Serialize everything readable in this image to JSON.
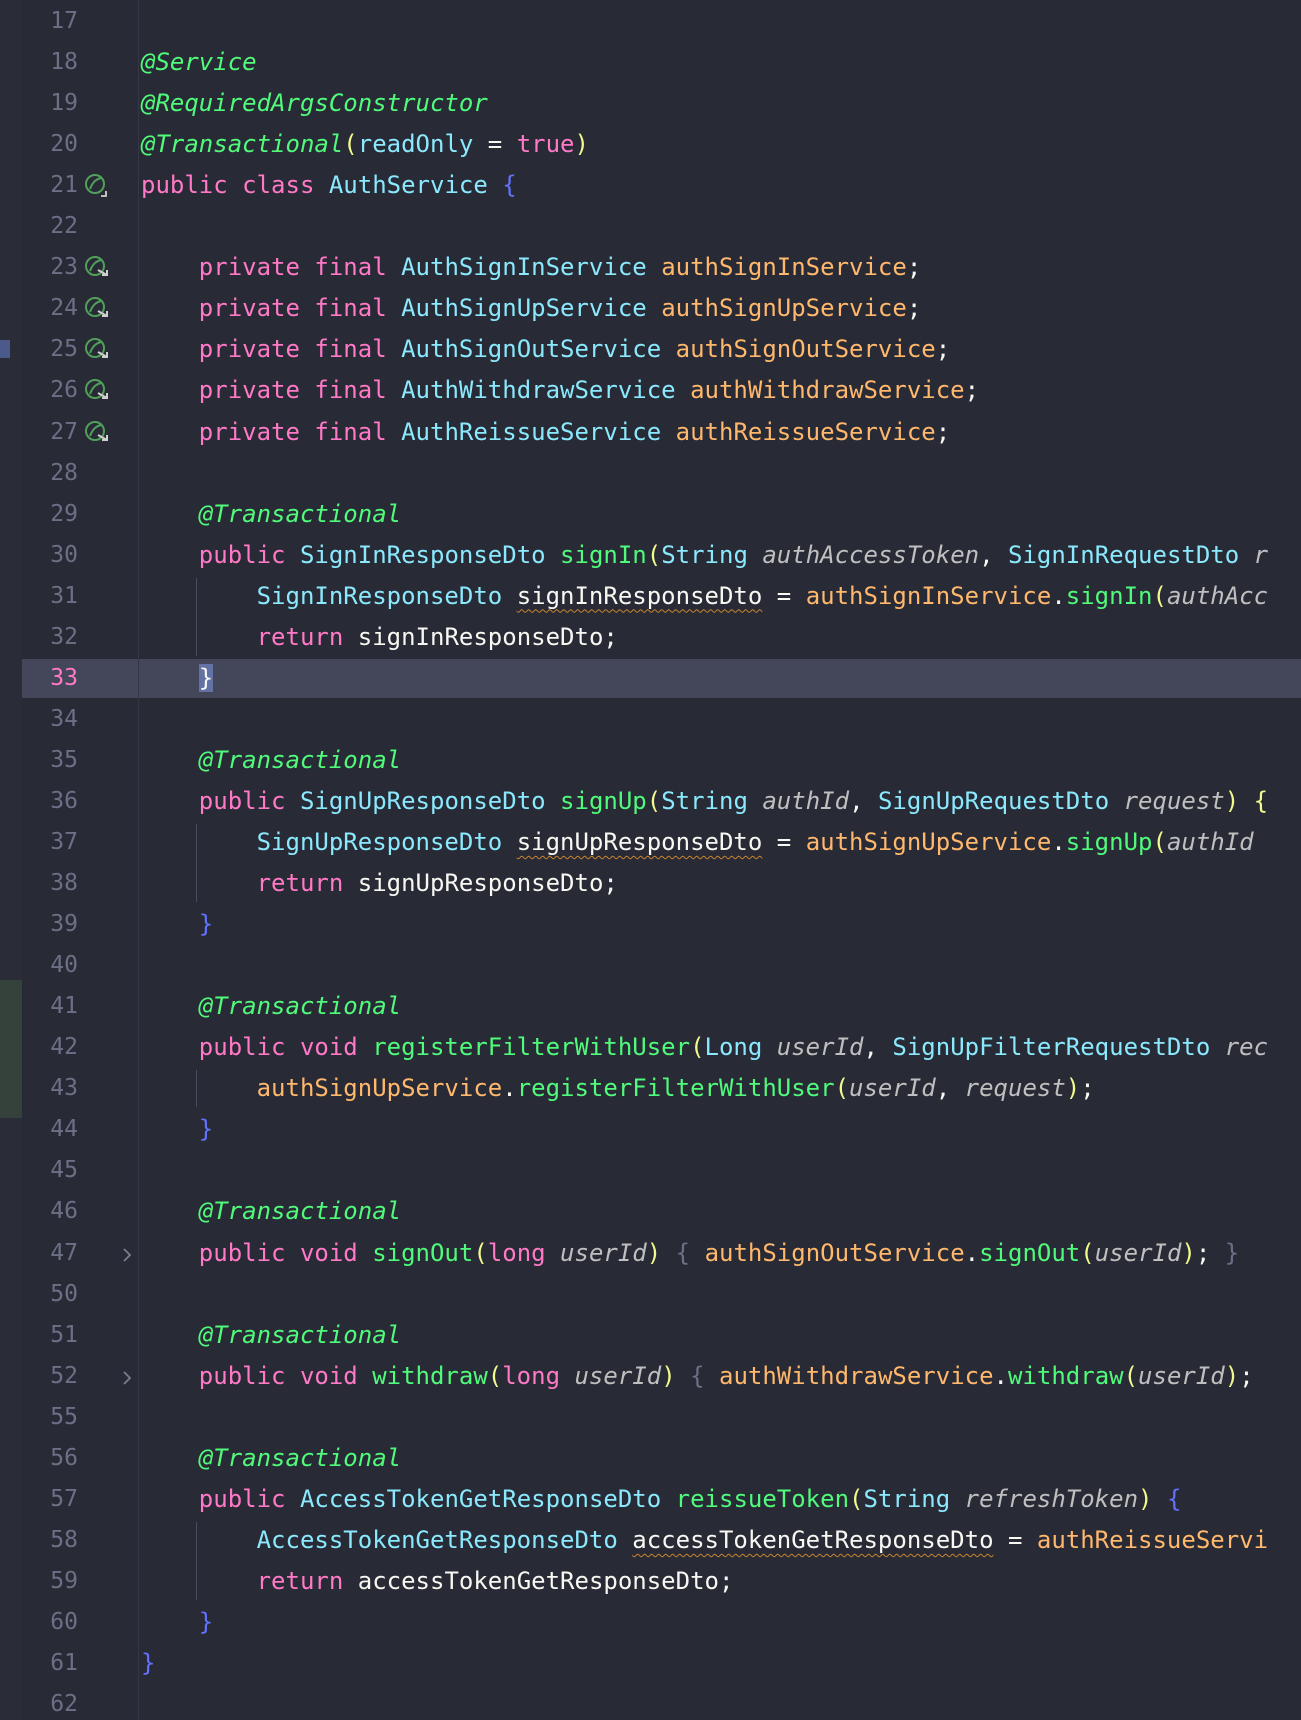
{
  "colors": {
    "background": "#282a36",
    "annotation": "#50fa7b",
    "keyword": "#ff79c6",
    "type": "#8be9fd",
    "field": "#ffb86c",
    "method": "#50fa7b",
    "param": "#bfbfbf",
    "plain": "#f8f8f2",
    "brace": "#6272ff",
    "paren": "#f1fa8c",
    "current_line_number": "#ff79c6"
  },
  "gutter_icons": [
    {
      "line": "21",
      "icon": "spring-bean-class-icon"
    },
    {
      "line": "23",
      "icon": "spring-bean-navigate-icon"
    },
    {
      "line": "24",
      "icon": "spring-bean-navigate-icon"
    },
    {
      "line": "25",
      "icon": "spring-bean-navigate-icon"
    },
    {
      "line": "26",
      "icon": "spring-bean-navigate-icon"
    },
    {
      "line": "27",
      "icon": "spring-bean-navigate-icon"
    }
  ],
  "fold_icons": [
    {
      "line": "47",
      "icon": "chevron-right-icon"
    },
    {
      "line": "52",
      "icon": "chevron-right-icon"
    }
  ],
  "current_line": "33",
  "lines": [
    {
      "n": "17",
      "tokens": []
    },
    {
      "n": "18",
      "tokens": [
        {
          "t": "@Service",
          "c": "annotation",
          "i": true
        }
      ]
    },
    {
      "n": "19",
      "tokens": [
        {
          "t": "@RequiredArgsConstructor",
          "c": "annotation",
          "i": true
        }
      ]
    },
    {
      "n": "20",
      "tokens": [
        {
          "t": "@Transactional",
          "c": "annotation",
          "i": true
        },
        {
          "t": "(",
          "c": "paren"
        },
        {
          "t": "readOnly",
          "c": "type"
        },
        {
          "t": " = ",
          "c": "plain"
        },
        {
          "t": "true",
          "c": "keyword"
        },
        {
          "t": ")",
          "c": "paren"
        }
      ]
    },
    {
      "n": "21",
      "tokens": [
        {
          "t": "public class ",
          "c": "keyword"
        },
        {
          "t": "AuthService",
          "c": "type"
        },
        {
          "t": " {",
          "c": "brace"
        }
      ]
    },
    {
      "n": "22",
      "tokens": []
    },
    {
      "n": "23",
      "tokens": [
        {
          "t": "    private final ",
          "c": "keyword"
        },
        {
          "t": "AuthSignInService ",
          "c": "type"
        },
        {
          "t": "authSignInService",
          "c": "field"
        },
        {
          "t": ";",
          "c": "plain"
        }
      ]
    },
    {
      "n": "24",
      "tokens": [
        {
          "t": "    private final ",
          "c": "keyword"
        },
        {
          "t": "AuthSignUpService ",
          "c": "type"
        },
        {
          "t": "authSignUpService",
          "c": "field"
        },
        {
          "t": ";",
          "c": "plain"
        }
      ]
    },
    {
      "n": "25",
      "tokens": [
        {
          "t": "    private final ",
          "c": "keyword"
        },
        {
          "t": "AuthSignOutService ",
          "c": "type"
        },
        {
          "t": "authSignOutService",
          "c": "field"
        },
        {
          "t": ";",
          "c": "plain"
        }
      ]
    },
    {
      "n": "26",
      "tokens": [
        {
          "t": "    private final ",
          "c": "keyword"
        },
        {
          "t": "AuthWithdrawService ",
          "c": "type"
        },
        {
          "t": "authWithdrawService",
          "c": "field"
        },
        {
          "t": ";",
          "c": "plain"
        }
      ]
    },
    {
      "n": "27",
      "tokens": [
        {
          "t": "    private final ",
          "c": "keyword"
        },
        {
          "t": "AuthReissueService ",
          "c": "type"
        },
        {
          "t": "authReissueService",
          "c": "field"
        },
        {
          "t": ";",
          "c": "plain"
        }
      ]
    },
    {
      "n": "28",
      "tokens": []
    },
    {
      "n": "29",
      "tokens": [
        {
          "t": "    @Transactional",
          "c": "annotation",
          "i": true
        }
      ]
    },
    {
      "n": "30",
      "tokens": [
        {
          "t": "    public ",
          "c": "keyword"
        },
        {
          "t": "SignInResponseDto ",
          "c": "type"
        },
        {
          "t": "signIn",
          "c": "method"
        },
        {
          "t": "(",
          "c": "paren"
        },
        {
          "t": "String ",
          "c": "type"
        },
        {
          "t": "authAccessToken",
          "c": "param",
          "i": true
        },
        {
          "t": ", ",
          "c": "plain"
        },
        {
          "t": "SignInRequestDto ",
          "c": "type"
        },
        {
          "t": "r",
          "c": "param",
          "i": true
        }
      ]
    },
    {
      "n": "31",
      "tokens": [
        {
          "t": "        SignInResponseDto ",
          "c": "type"
        },
        {
          "t": "signInResponseDto",
          "c": "plain",
          "w": true
        },
        {
          "t": " = ",
          "c": "plain"
        },
        {
          "t": "authSignInService",
          "c": "field"
        },
        {
          "t": ".",
          "c": "plain"
        },
        {
          "t": "signIn",
          "c": "method"
        },
        {
          "t": "(",
          "c": "paren"
        },
        {
          "t": "authAcc",
          "c": "param",
          "i": true
        }
      ]
    },
    {
      "n": "32",
      "tokens": [
        {
          "t": "        return ",
          "c": "keyword"
        },
        {
          "t": "signInResponseDto;",
          "c": "plain"
        }
      ]
    },
    {
      "n": "33",
      "tokens": [
        {
          "t": "    ",
          "c": "plain"
        },
        {
          "t": "}",
          "c": "plain",
          "caret": true
        }
      ]
    },
    {
      "n": "34",
      "tokens": []
    },
    {
      "n": "35",
      "tokens": [
        {
          "t": "    @Transactional",
          "c": "annotation",
          "i": true
        }
      ]
    },
    {
      "n": "36",
      "tokens": [
        {
          "t": "    public ",
          "c": "keyword"
        },
        {
          "t": "SignUpResponseDto ",
          "c": "type"
        },
        {
          "t": "signUp",
          "c": "method"
        },
        {
          "t": "(",
          "c": "paren"
        },
        {
          "t": "String ",
          "c": "type"
        },
        {
          "t": "authId",
          "c": "param",
          "i": true
        },
        {
          "t": ", ",
          "c": "plain"
        },
        {
          "t": "SignUpRequestDto ",
          "c": "type"
        },
        {
          "t": "request",
          "c": "param",
          "i": true
        },
        {
          "t": ") {",
          "c": "paren"
        }
      ]
    },
    {
      "n": "37",
      "tokens": [
        {
          "t": "        SignUpResponseDto ",
          "c": "type"
        },
        {
          "t": "signUpResponseDto",
          "c": "plain",
          "w": true
        },
        {
          "t": " = ",
          "c": "plain"
        },
        {
          "t": "authSignUpService",
          "c": "field"
        },
        {
          "t": ".",
          "c": "plain"
        },
        {
          "t": "signUp",
          "c": "method"
        },
        {
          "t": "(",
          "c": "paren"
        },
        {
          "t": "authId",
          "c": "param",
          "i": true
        }
      ]
    },
    {
      "n": "38",
      "tokens": [
        {
          "t": "        return ",
          "c": "keyword"
        },
        {
          "t": "signUpResponseDto;",
          "c": "plain"
        }
      ]
    },
    {
      "n": "39",
      "tokens": [
        {
          "t": "    }",
          "c": "brace"
        }
      ]
    },
    {
      "n": "40",
      "tokens": []
    },
    {
      "n": "41",
      "tokens": [
        {
          "t": "    @Transactional",
          "c": "annotation",
          "i": true
        }
      ]
    },
    {
      "n": "42",
      "tokens": [
        {
          "t": "    public void ",
          "c": "keyword"
        },
        {
          "t": "registerFilterWithUser",
          "c": "method"
        },
        {
          "t": "(",
          "c": "paren"
        },
        {
          "t": "Long ",
          "c": "type"
        },
        {
          "t": "userId",
          "c": "param",
          "i": true
        },
        {
          "t": ", ",
          "c": "plain"
        },
        {
          "t": "SignUpFilterRequestDto ",
          "c": "type"
        },
        {
          "t": "rec",
          "c": "param",
          "i": true
        }
      ]
    },
    {
      "n": "43",
      "tokens": [
        {
          "t": "        ",
          "c": "plain"
        },
        {
          "t": "authSignUpService",
          "c": "field"
        },
        {
          "t": ".",
          "c": "plain"
        },
        {
          "t": "registerFilterWithUser",
          "c": "method"
        },
        {
          "t": "(",
          "c": "paren"
        },
        {
          "t": "userId",
          "c": "param",
          "i": true
        },
        {
          "t": ", ",
          "c": "plain"
        },
        {
          "t": "request",
          "c": "param",
          "i": true
        },
        {
          "t": ")",
          "c": "paren"
        },
        {
          "t": ";",
          "c": "plain"
        }
      ]
    },
    {
      "n": "44",
      "tokens": [
        {
          "t": "    }",
          "c": "brace"
        }
      ]
    },
    {
      "n": "45",
      "tokens": []
    },
    {
      "n": "46",
      "tokens": [
        {
          "t": "    @Transactional",
          "c": "annotation",
          "i": true
        }
      ]
    },
    {
      "n": "47",
      "tokens": [
        {
          "t": "    public void ",
          "c": "keyword"
        },
        {
          "t": "signOut",
          "c": "method"
        },
        {
          "t": "(",
          "c": "paren"
        },
        {
          "t": "long ",
          "c": "keyword"
        },
        {
          "t": "userId",
          "c": "param",
          "i": true
        },
        {
          "t": ") ",
          "c": "paren"
        },
        {
          "t": "{ ",
          "c": "folded"
        },
        {
          "t": "authSignOutService",
          "c": "field"
        },
        {
          "t": ".",
          "c": "plain"
        },
        {
          "t": "signOut",
          "c": "method"
        },
        {
          "t": "(",
          "c": "paren"
        },
        {
          "t": "userId",
          "c": "param",
          "i": true
        },
        {
          "t": ")",
          "c": "paren"
        },
        {
          "t": "; ",
          "c": "plain"
        },
        {
          "t": "}",
          "c": "folded"
        }
      ]
    },
    {
      "n": "50",
      "tokens": []
    },
    {
      "n": "51",
      "tokens": [
        {
          "t": "    @Transactional",
          "c": "annotation",
          "i": true
        }
      ]
    },
    {
      "n": "52",
      "tokens": [
        {
          "t": "    public void ",
          "c": "keyword"
        },
        {
          "t": "withdraw",
          "c": "method"
        },
        {
          "t": "(",
          "c": "paren"
        },
        {
          "t": "long ",
          "c": "keyword"
        },
        {
          "t": "userId",
          "c": "param",
          "i": true
        },
        {
          "t": ") ",
          "c": "paren"
        },
        {
          "t": "{ ",
          "c": "folded"
        },
        {
          "t": "authWithdrawService",
          "c": "field"
        },
        {
          "t": ".",
          "c": "plain"
        },
        {
          "t": "withdraw",
          "c": "method"
        },
        {
          "t": "(",
          "c": "paren"
        },
        {
          "t": "userId",
          "c": "param",
          "i": true
        },
        {
          "t": ")",
          "c": "paren"
        },
        {
          "t": ";",
          "c": "plain"
        }
      ]
    },
    {
      "n": "55",
      "tokens": []
    },
    {
      "n": "56",
      "tokens": [
        {
          "t": "    @Transactional",
          "c": "annotation",
          "i": true
        }
      ]
    },
    {
      "n": "57",
      "tokens": [
        {
          "t": "    public ",
          "c": "keyword"
        },
        {
          "t": "AccessTokenGetResponseDto ",
          "c": "type"
        },
        {
          "t": "reissueToken",
          "c": "method"
        },
        {
          "t": "(",
          "c": "paren"
        },
        {
          "t": "String ",
          "c": "type"
        },
        {
          "t": "refreshToken",
          "c": "param",
          "i": true
        },
        {
          "t": ") ",
          "c": "paren"
        },
        {
          "t": "{",
          "c": "brace"
        }
      ]
    },
    {
      "n": "58",
      "tokens": [
        {
          "t": "        AccessTokenGetResponseDto ",
          "c": "type"
        },
        {
          "t": "accessTokenGetResponseDto",
          "c": "plain",
          "w": true
        },
        {
          "t": " = ",
          "c": "plain"
        },
        {
          "t": "authReissueServi",
          "c": "field"
        }
      ]
    },
    {
      "n": "59",
      "tokens": [
        {
          "t": "        return ",
          "c": "keyword"
        },
        {
          "t": "accessTokenGetResponseDto;",
          "c": "plain"
        }
      ]
    },
    {
      "n": "60",
      "tokens": [
        {
          "t": "    }",
          "c": "brace"
        }
      ]
    },
    {
      "n": "61",
      "tokens": [
        {
          "t": "}",
          "c": "brace"
        }
      ]
    },
    {
      "n": "62",
      "tokens": []
    }
  ]
}
